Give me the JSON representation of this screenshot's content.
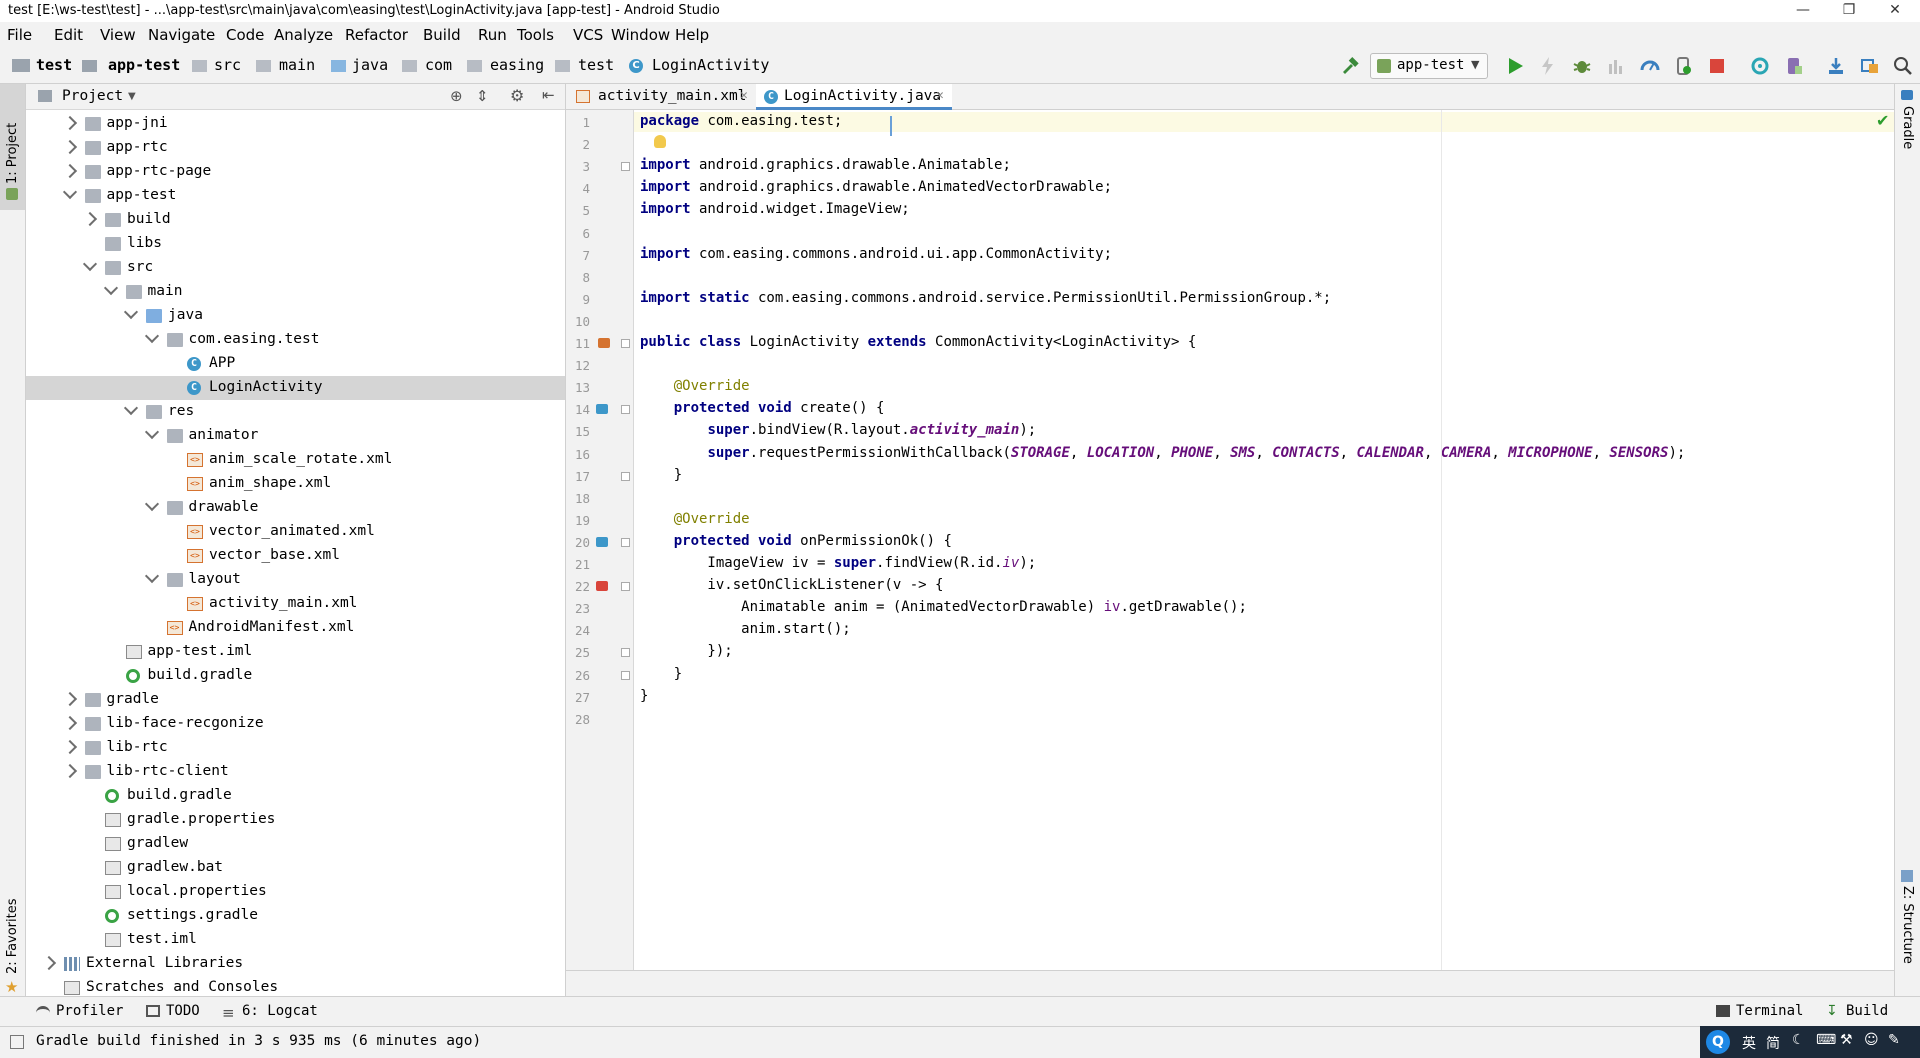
{
  "window": {
    "title": "test [E:\\ws-test\\test] - ...\\app-test\\src\\main\\java\\com\\easing\\test\\LoginActivity.java [app-test] - Android Studio",
    "controls": [
      "minimize",
      "restore",
      "close"
    ]
  },
  "menu": [
    "File",
    "Edit",
    "View",
    "Navigate",
    "Code",
    "Analyze",
    "Refactor",
    "Build",
    "Run",
    "Tools",
    "VCS",
    "Window",
    "Help"
  ],
  "breadcrumb": [
    "test",
    "app-test",
    "src",
    "main",
    "java",
    "com",
    "easing",
    "test",
    "LoginActivity"
  ],
  "toolbar": {
    "run_config": "app-test",
    "icons": [
      "hammer-icon",
      "run-icon",
      "apply-changes-icon",
      "debug-icon",
      "attach-debugger-icon",
      "profile-icon",
      "stop-icon",
      "sync-icon",
      "avd-manager-icon",
      "sdk-manager-icon",
      "project-structure-icon",
      "search-everywhere-icon"
    ]
  },
  "side_tools": {
    "left_top": "1: Project",
    "left_bottom": "2: Favorites",
    "right_top": "Gradle",
    "right_bottom": "Z: Structure"
  },
  "project_panel": {
    "title": "Project",
    "tree": [
      {
        "label": "app-jni",
        "depth": 1,
        "arrow": "right",
        "icon": "module-folder"
      },
      {
        "label": "app-rtc",
        "depth": 1,
        "arrow": "right",
        "icon": "module-folder"
      },
      {
        "label": "app-rtc-page",
        "depth": 1,
        "arrow": "right",
        "icon": "module-folder"
      },
      {
        "label": "app-test",
        "depth": 1,
        "arrow": "down",
        "icon": "module-folder"
      },
      {
        "label": "build",
        "depth": 2,
        "arrow": "right",
        "icon": "folder"
      },
      {
        "label": "libs",
        "depth": 2,
        "arrow": "",
        "icon": "folder"
      },
      {
        "label": "src",
        "depth": 2,
        "arrow": "down",
        "icon": "folder"
      },
      {
        "label": "main",
        "depth": 3,
        "arrow": "down",
        "icon": "folder"
      },
      {
        "label": "java",
        "depth": 4,
        "arrow": "down",
        "icon": "source-folder"
      },
      {
        "label": "com.easing.test",
        "depth": 5,
        "arrow": "down",
        "icon": "package"
      },
      {
        "label": "APP",
        "depth": 6,
        "arrow": "",
        "icon": "class"
      },
      {
        "label": "LoginActivity",
        "depth": 6,
        "arrow": "",
        "icon": "class",
        "selected": true
      },
      {
        "label": "res",
        "depth": 4,
        "arrow": "down",
        "icon": "folder"
      },
      {
        "label": "animator",
        "depth": 5,
        "arrow": "down",
        "icon": "package"
      },
      {
        "label": "anim_scale_rotate.xml",
        "depth": 6,
        "arrow": "",
        "icon": "xml"
      },
      {
        "label": "anim_shape.xml",
        "depth": 6,
        "arrow": "",
        "icon": "xml"
      },
      {
        "label": "drawable",
        "depth": 5,
        "arrow": "down",
        "icon": "package"
      },
      {
        "label": "vector_animated.xml",
        "depth": 6,
        "arrow": "",
        "icon": "xml"
      },
      {
        "label": "vector_base.xml",
        "depth": 6,
        "arrow": "",
        "icon": "xml"
      },
      {
        "label": "layout",
        "depth": 5,
        "arrow": "down",
        "icon": "package"
      },
      {
        "label": "activity_main.xml",
        "depth": 6,
        "arrow": "",
        "icon": "xml"
      },
      {
        "label": "AndroidManifest.xml",
        "depth": 5,
        "arrow": "",
        "icon": "manifest"
      },
      {
        "label": "app-test.iml",
        "depth": 3,
        "arrow": "",
        "icon": "file"
      },
      {
        "label": "build.gradle",
        "depth": 3,
        "arrow": "",
        "icon": "gradle"
      },
      {
        "label": "gradle",
        "depth": 1,
        "arrow": "right",
        "icon": "folder"
      },
      {
        "label": "lib-face-recgonize",
        "depth": 1,
        "arrow": "right",
        "icon": "module-folder"
      },
      {
        "label": "lib-rtc",
        "depth": 1,
        "arrow": "right",
        "icon": "module-folder"
      },
      {
        "label": "lib-rtc-client",
        "depth": 1,
        "arrow": "right",
        "icon": "module-folder"
      },
      {
        "label": "build.gradle",
        "depth": 2,
        "arrow": "",
        "icon": "gradle"
      },
      {
        "label": "gradle.properties",
        "depth": 2,
        "arrow": "",
        "icon": "file"
      },
      {
        "label": "gradlew",
        "depth": 2,
        "arrow": "",
        "icon": "file"
      },
      {
        "label": "gradlew.bat",
        "depth": 2,
        "arrow": "",
        "icon": "file"
      },
      {
        "label": "local.properties",
        "depth": 2,
        "arrow": "",
        "icon": "file"
      },
      {
        "label": "settings.gradle",
        "depth": 2,
        "arrow": "",
        "icon": "gradle"
      },
      {
        "label": "test.iml",
        "depth": 2,
        "arrow": "",
        "icon": "file"
      },
      {
        "label": "External Libraries",
        "depth": 0,
        "arrow": "right",
        "icon": "library"
      },
      {
        "label": "Scratches and Consoles",
        "depth": 0,
        "arrow": "",
        "icon": "scratches"
      }
    ]
  },
  "editor": {
    "tabs": [
      {
        "label": "activity_main.xml",
        "active": false
      },
      {
        "label": "LoginActivity.java",
        "active": true
      }
    ],
    "lines": [
      [
        [
          "kw",
          "package"
        ],
        [
          "p",
          " com.easing.test;"
        ]
      ],
      [],
      [
        [
          "kw",
          "import"
        ],
        [
          "p",
          " android.graphics.drawable.Animatable;"
        ]
      ],
      [
        [
          "kw",
          "import"
        ],
        [
          "p",
          " android.graphics.drawable.AnimatedVectorDrawable;"
        ]
      ],
      [
        [
          "kw",
          "import"
        ],
        [
          "p",
          " android.widget.ImageView;"
        ]
      ],
      [],
      [
        [
          "kw",
          "import"
        ],
        [
          "p",
          " com.easing.commons.android.ui.app.CommonActivity;"
        ]
      ],
      [],
      [
        [
          "kw",
          "import static"
        ],
        [
          "p",
          " com.easing.commons.android.service.PermissionUtil.PermissionGroup.*;"
        ]
      ],
      [],
      [
        [
          "kw",
          "public class"
        ],
        [
          "p",
          " LoginActivity "
        ],
        [
          "kw",
          "extends"
        ],
        [
          "p",
          " CommonActivity<LoginActivity> {"
        ]
      ],
      [],
      [
        [
          "p",
          "    "
        ],
        [
          "ann",
          "@Override"
        ]
      ],
      [
        [
          "p",
          "    "
        ],
        [
          "kw",
          "protected void"
        ],
        [
          "p",
          " create() {"
        ]
      ],
      [
        [
          "p",
          "        "
        ],
        [
          "kw",
          "super"
        ],
        [
          "p",
          ".bindView(R.layout."
        ],
        [
          "cst",
          "activity_main"
        ],
        [
          "p",
          ");"
        ]
      ],
      [
        [
          "p",
          "        "
        ],
        [
          "kw",
          "super"
        ],
        [
          "p",
          ".requestPermissionWithCallback("
        ],
        [
          "cst",
          "STORAGE"
        ],
        [
          "p",
          ", "
        ],
        [
          "cst",
          "LOCATION"
        ],
        [
          "p",
          ", "
        ],
        [
          "cst",
          "PHONE"
        ],
        [
          "p",
          ", "
        ],
        [
          "cst",
          "SMS"
        ],
        [
          "p",
          ", "
        ],
        [
          "cst",
          "CONTACTS"
        ],
        [
          "p",
          ", "
        ],
        [
          "cst",
          "CALENDAR"
        ],
        [
          "p",
          ", "
        ],
        [
          "cst",
          "CAMERA"
        ],
        [
          "p",
          ", "
        ],
        [
          "cst",
          "MICROPHONE"
        ],
        [
          "p",
          ", "
        ],
        [
          "cst",
          "SENSORS"
        ],
        [
          "p",
          ");"
        ]
      ],
      [
        [
          "p",
          "    }"
        ]
      ],
      [],
      [
        [
          "p",
          "    "
        ],
        [
          "ann",
          "@Override"
        ]
      ],
      [
        [
          "p",
          "    "
        ],
        [
          "kw",
          "protected void"
        ],
        [
          "p",
          " onPermissionOk() {"
        ]
      ],
      [
        [
          "p",
          "        ImageView iv = "
        ],
        [
          "kw",
          "super"
        ],
        [
          "p",
          ".findView(R.id."
        ],
        [
          "fldi",
          "iv"
        ],
        [
          "p",
          ");"
        ]
      ],
      [
        [
          "p",
          "        iv.setOnClickListener(v -> {"
        ]
      ],
      [
        [
          "p",
          "            Animatable anim = (AnimatedVectorDrawable) "
        ],
        [
          "vr",
          "iv"
        ],
        [
          "p",
          ".getDrawable();"
        ]
      ],
      [
        [
          "p",
          "            anim.start();"
        ]
      ],
      [
        [
          "p",
          "        });"
        ]
      ],
      [
        [
          "p",
          "    }"
        ]
      ],
      [
        [
          "p",
          "}"
        ]
      ],
      []
    ]
  },
  "bottom_tools": {
    "profiler": "Profiler",
    "todo": "TODO",
    "logcat": "6: Logcat",
    "terminal": "Terminal",
    "build": "Build"
  },
  "status": {
    "message": "Gradle build finished in 3 s 935 ms (6 minutes ago)"
  },
  "ime": [
    "英",
    "简"
  ]
}
